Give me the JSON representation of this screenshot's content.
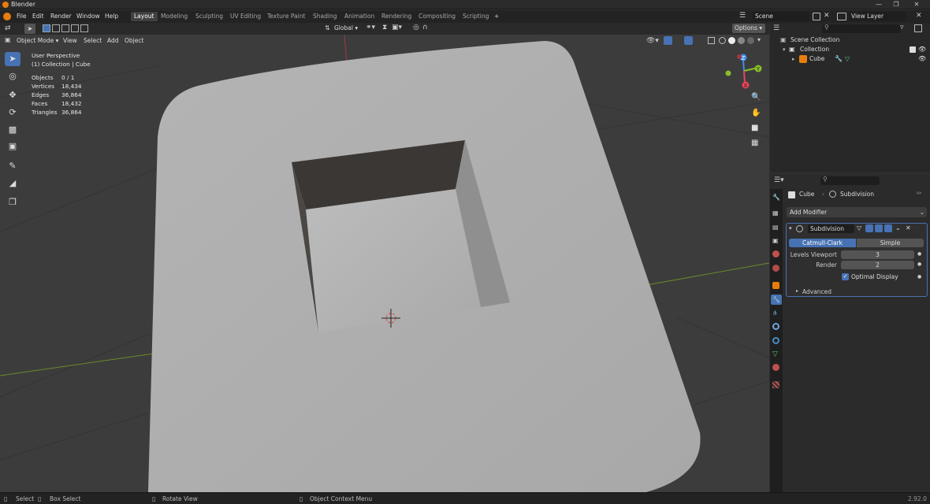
{
  "app": {
    "title": "Blender",
    "version": "2.92.0"
  },
  "menus": [
    "File",
    "Edit",
    "Render",
    "Window",
    "Help"
  ],
  "workspaces": [
    "Layout",
    "Modeling",
    "Sculpting",
    "UV Editing",
    "Texture Paint",
    "Shading",
    "Animation",
    "Rendering",
    "Compositing",
    "Scripting"
  ],
  "workspace_active": "Layout",
  "workspace_add": "+",
  "scene": {
    "label": "Scene",
    "view_layer": "View Layer"
  },
  "viewport_header": {
    "mode": "Object Mode",
    "menus": [
      "View",
      "Select",
      "Add",
      "Object"
    ],
    "orientation": "Global",
    "options": "Options"
  },
  "overlay": {
    "view_name": "User Perspective",
    "collection_info": "(1) Collection | Cube",
    "stats": [
      {
        "label": "Objects",
        "value": "0 / 1"
      },
      {
        "label": "Vertices",
        "value": "18,434"
      },
      {
        "label": "Edges",
        "value": "36,864"
      },
      {
        "label": "Faces",
        "value": "18,432"
      },
      {
        "label": "Triangles",
        "value": "36,864"
      }
    ]
  },
  "gizmo": {
    "z": "Z",
    "y": "Y",
    "x": "X"
  },
  "outliner": {
    "root": "Scene Collection",
    "collection": "Collection",
    "object": "Cube"
  },
  "properties": {
    "object_name": "Cube",
    "modifier_breadcrumb": "Subdivision",
    "add_modifier": "Add Modifier",
    "modifier": {
      "name": "Subdivision",
      "type_options": [
        "Catmull-Clark",
        "Simple"
      ],
      "type_selected": "Catmull-Clark",
      "levels_viewport_label": "Levels Viewport",
      "levels_viewport": "3",
      "render_label": "Render",
      "render": "2",
      "optimal_display_label": "Optimal Display",
      "optimal_display": true,
      "advanced_label": "Advanced"
    }
  },
  "statusbar": {
    "select": "Select",
    "box_select": "Box Select",
    "rotate_view": "Rotate View",
    "context_menu": "Object Context Menu",
    "version": "2.92.0"
  },
  "colors": {
    "accent": "#4772b3",
    "x_axis": "#e8445a",
    "y_axis": "#8bbd2a",
    "z_axis": "#3d8ee8",
    "orange": "#e87d0d"
  }
}
